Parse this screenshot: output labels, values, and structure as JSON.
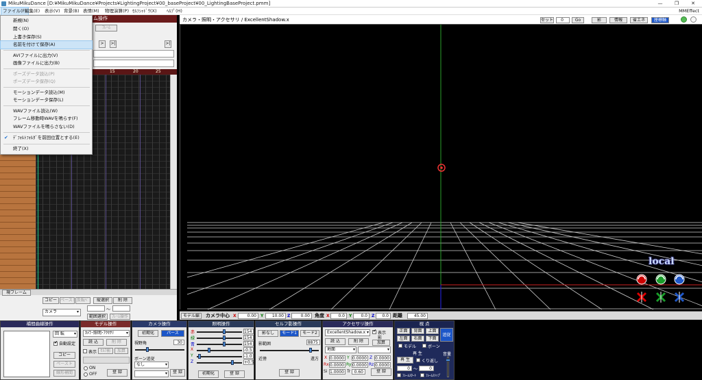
{
  "window": {
    "title": "MikuMikuDance [D:¥MikuMikuDance¥Projects¥LightingProject¥00_baseProject¥00_LightingBaseProject.pmm]",
    "minimize": "—",
    "maximize": "❐",
    "close": "✕"
  },
  "menubar": {
    "items": [
      "ファイル(F)",
      "編集(E)",
      "表示(V)",
      "背景(B)",
      "表情(M)",
      "物理演算(P)",
      "ｾﾙﾌｼｬﾄﾞｳ(X)",
      "ﾍﾙﾌﾟ(H)"
    ],
    "right_label": "MMEffect"
  },
  "file_menu": {
    "items": [
      {
        "label": "新規(N)",
        "disabled": false
      },
      {
        "label": "開く(O)",
        "disabled": false
      },
      {
        "label": "上書き保存(S)",
        "disabled": false
      },
      {
        "label": "名前を付けて保存(A)",
        "disabled": false,
        "highlighted": true
      },
      {
        "label": "AVIファイルに出力(V)",
        "disabled": false
      },
      {
        "label": "画像ファイルに出力(B)",
        "disabled": false
      },
      {
        "label": "ポーズデータ読込(P)",
        "disabled": true
      },
      {
        "label": "ポーズデータ保存(Q)",
        "disabled": true
      },
      {
        "label": "モーションデータ読込(M)",
        "disabled": false
      },
      {
        "label": "モーションデータ保存(L)",
        "disabled": false
      },
      {
        "label": "WAVファイル読込(W)",
        "disabled": false
      },
      {
        "label": "フレーム移動時WAVを鳴らす(F)",
        "disabled": false
      },
      {
        "label": "WAVファイルを鳴らさない(D)",
        "disabled": false
      },
      {
        "label": "ﾃﾞﾌｫﾙﾄﾌｫﾙﾀﾞを前回位置とする(E)",
        "disabled": false,
        "checked": true
      },
      {
        "label": "終了(X)",
        "disabled": false
      }
    ]
  },
  "timeline": {
    "header": "ム操作",
    "ruler_ticks": [
      "15",
      "20",
      "25"
    ],
    "current_frame_label": "現フレーム",
    "buttons": {
      "copy": "コピー",
      "paste": "ペースト",
      "reverse": "反転ﾍﾟ",
      "range_select": "縦選択",
      "delete": "削 除",
      "range_select2": "範囲選択",
      "expand": "ﾌﾚｰﾑ操作"
    },
    "target_select": "カメラ",
    "range_sep": "～"
  },
  "viewport": {
    "title": "カメラ・照明・アクセサリ / ExcellentShadow.x",
    "controls": {
      "set_label": "セット",
      "set_value": "0",
      "go": "Go",
      "shadow": "影",
      "info": "情報",
      "eco": "省エネ",
      "axis": "座標軸"
    },
    "overlay_local": "local",
    "bottom": {
      "model_op": "モデル編",
      "camera_center": "カメラ中心",
      "x_label": "X",
      "x_value": "0.00",
      "y_label": "Y",
      "y_value": "10.00",
      "z_label": "Z",
      "z_value": "0.00",
      "angle": "角度",
      "ax_label": "X",
      "ax_value": "0.0",
      "ay_label": "Y",
      "ay_value": "0.0",
      "az_label": "Z",
      "az_value": "0.0",
      "distance": "距離",
      "distance_value": "45.00"
    }
  },
  "panels": {
    "interp": {
      "title": "補間曲線操作",
      "rotate": "回 転",
      "auto": "自動設定",
      "copy": "コピー",
      "paste": "ペースト",
      "linear": "線形補間"
    },
    "model": {
      "title": "モデル操作",
      "select": "ｶﾒﾗ･照明･ｱｸｾｻﾘ",
      "load": "読 込",
      "delete": "削 除",
      "display": "表示",
      "shadow": "ｾﾙﾌ影",
      "add": "加算",
      "on": "ON",
      "off": "OFF",
      "register": "登 録"
    },
    "camera": {
      "title": "カメラ操作",
      "init": "初期化",
      "perspective": "パース",
      "view_angle": "視野角",
      "view_value": "30",
      "follow": "ボーン追従",
      "follow_value": "なし",
      "register": "登 録"
    },
    "light": {
      "title": "照明操作",
      "labels": [
        "赤",
        "緑",
        "青",
        "X",
        "Y",
        "Z"
      ],
      "values": [
        "154",
        "154",
        "154",
        "-0.5",
        "-1.0",
        "+0.5"
      ],
      "init": "初期化",
      "register": "登 録"
    },
    "selfshadow": {
      "title": "セルフ影操作",
      "none": "影なし",
      "mode1": "モード1",
      "mode2": "モード2",
      "range": "影範囲",
      "range_value": "8875",
      "near": "近傍",
      "far": "遠方",
      "register": "登 録"
    },
    "accessory": {
      "title": "アクセサリ操作",
      "select": "ExcellentShadow.x",
      "show": "表示",
      "shadow": "影",
      "load": "読 込",
      "delete": "削 除",
      "add": "加算",
      "ground": "地面",
      "x": "X",
      "y": "Y",
      "z": "Z",
      "rx": "Rx",
      "ry": "Ry",
      "rz": "Rz",
      "si": "Si",
      "tr": "Tr",
      "xv": "0.0000",
      "yv": "0.0000",
      "zv": "0.0000",
      "rxv": "0.0000",
      "ryv": "0.0000",
      "rzv": "0.0000",
      "siv": "1.0000",
      "trv": "0.60",
      "register": "登 録"
    },
    "view": {
      "title": "視 点",
      "front": "正面",
      "back": "背面",
      "top": "上面",
      "left": "左面",
      "right": "右面",
      "bottom": "下面",
      "follow": "追従",
      "model": "モデル",
      "bone": "ボーン",
      "play_title": "再 生",
      "play": "再 生",
      "repeat": "くり返し",
      "from": "0",
      "to": "0",
      "frame_start": "ﾌﾚｰﾑｽﾀｰﾄ",
      "frame_stop": "ﾌﾚｰﾑｽﾄｯﾌﾟ",
      "volume": "音量"
    }
  }
}
